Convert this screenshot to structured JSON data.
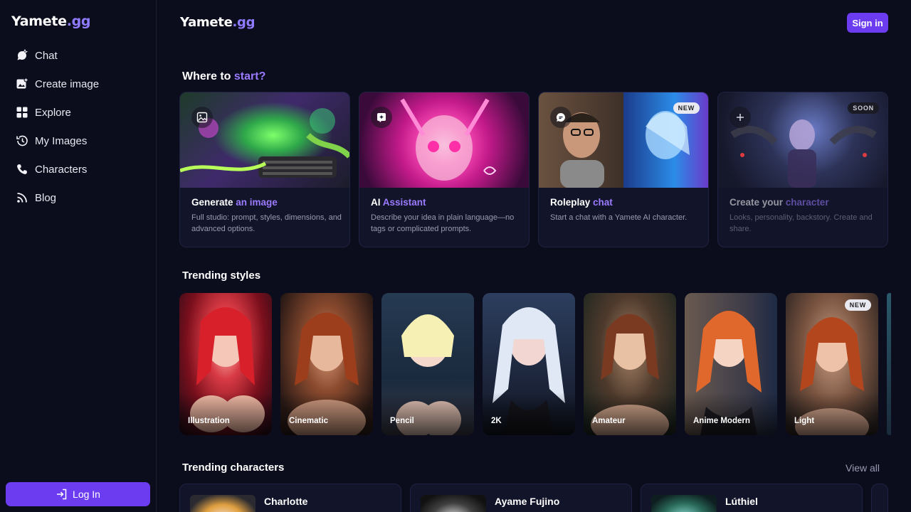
{
  "brand": {
    "name": "Yamete",
    "tld": ".gg"
  },
  "sidebar": {
    "items": [
      {
        "label": "Chat",
        "icon": "chat-sparkle-icon"
      },
      {
        "label": "Create image",
        "icon": "image-add-icon"
      },
      {
        "label": "Explore",
        "icon": "grid-icon"
      },
      {
        "label": "My Images",
        "icon": "history-icon"
      },
      {
        "label": "Characters",
        "icon": "person-phone-icon"
      },
      {
        "label": "Blog",
        "icon": "rss-icon"
      }
    ],
    "login_label": "Log In"
  },
  "header": {
    "signin_label": "Sign in"
  },
  "start": {
    "title_prefix": "Where to ",
    "title_accent": "start?",
    "cards": [
      {
        "title_a": "Generate ",
        "title_b": "an image",
        "desc": "Full studio: prompt, styles, dimensions, and advanced options.",
        "icon": "image-icon",
        "badge": ""
      },
      {
        "title_a": "AI ",
        "title_b": "Assistant",
        "desc": "Describe your idea in plain language—no tags or complicated prompts.",
        "icon": "sparkle-square-icon",
        "badge": ""
      },
      {
        "title_a": "Roleplay ",
        "title_b": "chat",
        "desc": "Start a chat with a Yamete AI character.",
        "icon": "chat-bubble-icon",
        "badge": "NEW"
      },
      {
        "title_a": "Create your ",
        "title_b": "character",
        "desc": "Looks, personality, backstory. Create and share.",
        "icon": "plus-icon",
        "badge": "SOON"
      }
    ]
  },
  "styles": {
    "title": "Trending styles",
    "items": [
      {
        "label": "Illustration",
        "badge": ""
      },
      {
        "label": "Cinematic",
        "badge": ""
      },
      {
        "label": "Pencil",
        "badge": ""
      },
      {
        "label": "2K",
        "badge": ""
      },
      {
        "label": "Amateur",
        "badge": ""
      },
      {
        "label": "Anime Modern",
        "badge": ""
      },
      {
        "label": "Light",
        "badge": "NEW"
      }
    ]
  },
  "characters": {
    "title": "Trending characters",
    "view_all": "View all",
    "items": [
      {
        "name": "Charlotte"
      },
      {
        "name": "Ayame Fujino"
      },
      {
        "name": "Lúthiel"
      }
    ]
  },
  "colors": {
    "accent": "#6b3cf0",
    "accent_text": "#9b7bff",
    "background": "#0b0c1c",
    "card": "#12142a"
  }
}
